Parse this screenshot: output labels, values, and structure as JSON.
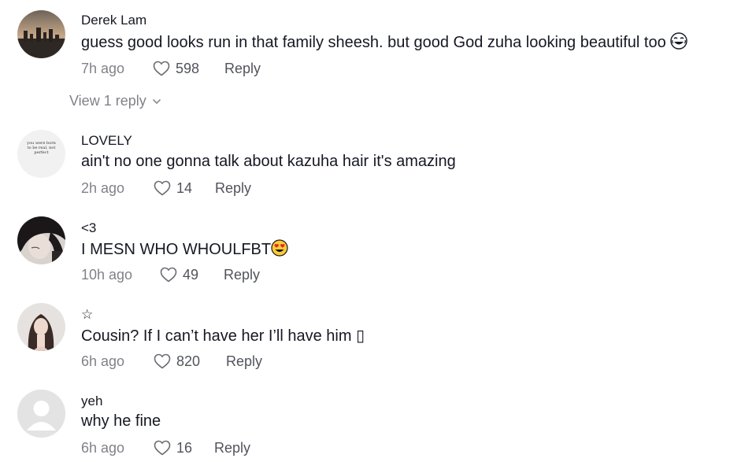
{
  "comments": [
    {
      "username": "Derek Lam",
      "text": "guess good looks run in that family sheesh. but good God zuha looking beautiful too",
      "emoji": "laughing-tears-emoji",
      "time": "7h ago",
      "likes": "598",
      "reply_label": "Reply",
      "avatar": "city-skyline-avatar"
    },
    {
      "username": "LOVELY",
      "text": "ain't no one gonna talk about kazuha hair it's amazing",
      "time": "2h ago",
      "likes": "14",
      "reply_label": "Reply",
      "avatar": "text-quote-avatar",
      "avatar_text": "you were born to be real, not perfect"
    },
    {
      "username": "<3",
      "text": "I MESN WHO WHOULFBT",
      "emoji": "heart-eyes-emoji",
      "time": "10h ago",
      "likes": "49",
      "reply_label": "Reply",
      "avatar": "dark-hair-portrait-avatar"
    },
    {
      "username": "☆",
      "text": "Cousin? If I can’t have her I’ll have him",
      "trailing_glyph": "▯",
      "time": "6h ago",
      "likes": "820",
      "reply_label": "Reply",
      "avatar": "woman-portrait-avatar"
    },
    {
      "username": "yeh",
      "text": "why he fine",
      "time": "6h ago",
      "likes": "16",
      "reply_label": "Reply",
      "avatar": "default-user-avatar"
    }
  ],
  "view_replies": "View 1 reply",
  "colors": {
    "text": "#161823",
    "muted": "#8a8b91",
    "default_avatar_bg": "#e3e3e4"
  }
}
